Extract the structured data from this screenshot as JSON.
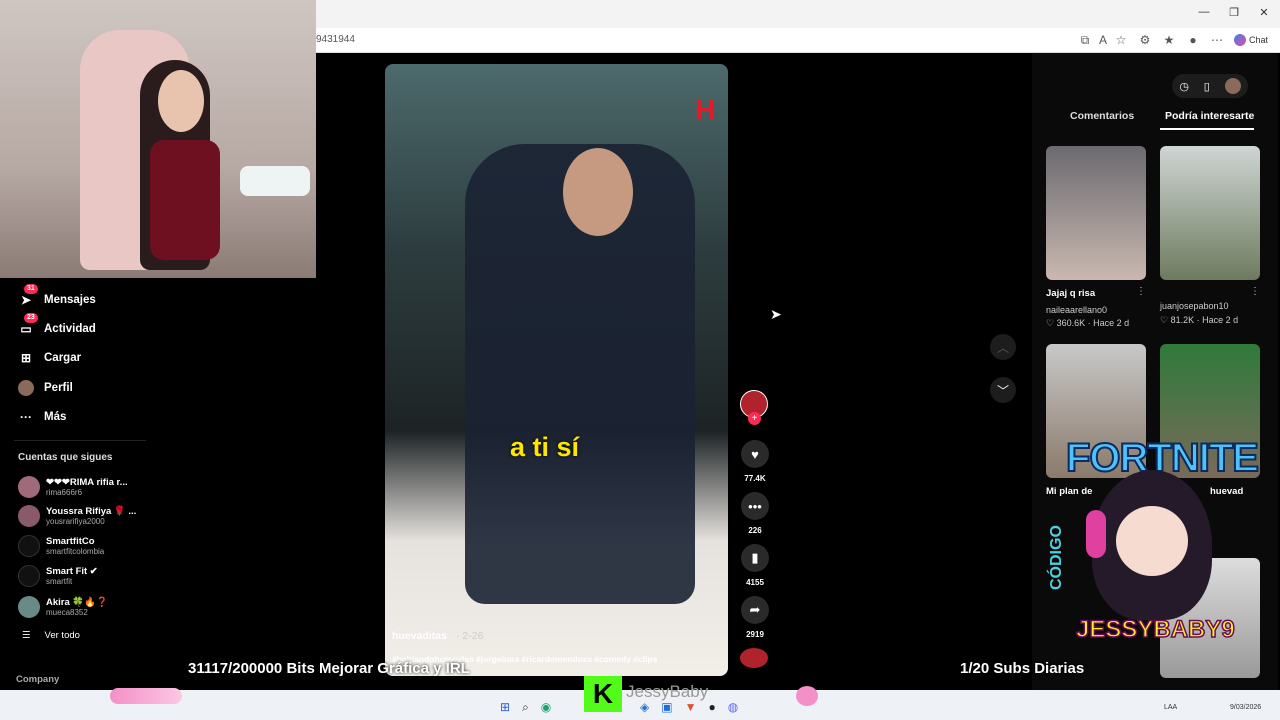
{
  "browser": {
    "url_fragment": "9431944",
    "chat_label": "Chat"
  },
  "sidebar": {
    "items": [
      {
        "label": "Mensajes",
        "icon": "send-icon",
        "badge": "31"
      },
      {
        "label": "Actividad",
        "icon": "inbox-icon",
        "badge": "23"
      },
      {
        "label": "Cargar",
        "icon": "upload-icon",
        "badge": ""
      },
      {
        "label": "Perfil",
        "icon": "avatar-icon",
        "badge": ""
      },
      {
        "label": "Más",
        "icon": "more-icon",
        "badge": ""
      }
    ],
    "following_title": "Cuentas que sigues",
    "accounts": [
      {
        "name": "❤❤❤RIMA rifia r...",
        "user": "rima666r6"
      },
      {
        "name": "Youssra Rifiya 🌹 ...",
        "user": "yousrarifiya2000"
      },
      {
        "name": "SmartfitCo",
        "user": "smartfitcolombia"
      },
      {
        "name": "Smart Fit ✔",
        "user": "smartfit"
      },
      {
        "name": "Akira 🍀🔥❓",
        "user": "mueca8352"
      }
    ],
    "see_all": "Ver todo",
    "company": "Company"
  },
  "video": {
    "subtitle": "a ti sí",
    "author": "huevaditas",
    "date": "· 2-26",
    "tags": "#hablandohuevadas #jorgeluna #ricardomendoza #comedy #clips"
  },
  "actions": [
    {
      "icon": "heart-icon",
      "count": "77.4K"
    },
    {
      "icon": "comment-icon",
      "count": "226"
    },
    {
      "icon": "bookmark-icon",
      "count": "4155"
    },
    {
      "icon": "share-icon",
      "count": "2919"
    }
  ],
  "right_panel": {
    "tabs": [
      "Comentarios",
      "Podría interesarte"
    ],
    "cards": [
      {
        "title": "Jajaj q risa",
        "user": "naileaarellano0",
        "stats": "♡ 360.6K · Hace 2 d"
      },
      {
        "title": "",
        "user": "juanjosepabon10",
        "stats": "♡ 81.2K · Hace 2 d"
      },
      {
        "title": "Mi plan de",
        "user": "",
        "stats": ""
      },
      {
        "title": "huevad",
        "user": "",
        "stats": ""
      }
    ]
  },
  "overlay": {
    "bits": "31117/200000 Bits Mejorar Gráfica y IRL",
    "subs": "1/20 Subs Diarias",
    "fortnite": "FORTNITE",
    "codigo": "CÓDIGO",
    "code": "JESSYBABY9",
    "kick_name": "JessyBaby"
  },
  "taskbar": {
    "lang": "LAA",
    "date": "9/03/2026"
  }
}
